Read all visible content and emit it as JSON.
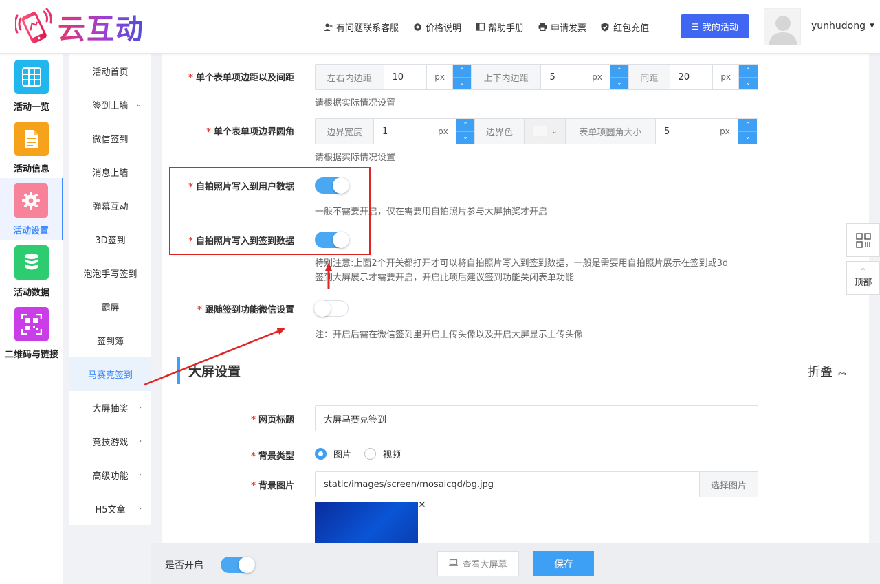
{
  "brand": {
    "name": "云互动"
  },
  "topnav": {
    "items": [
      {
        "label": "有问题联系客服",
        "icon": "user-plus-icon"
      },
      {
        "label": "价格说明",
        "icon": "gear-icon"
      },
      {
        "label": "帮助手册",
        "icon": "book-icon"
      },
      {
        "label": "申请发票",
        "icon": "printer-icon"
      },
      {
        "label": "红包充值",
        "icon": "shield-check-icon"
      }
    ],
    "my_activity": "我的活动",
    "username": "yunhudong"
  },
  "iconbar": {
    "items": [
      {
        "label": "活动一览",
        "icon": "grid-icon",
        "color": "#1fb7ee"
      },
      {
        "label": "活动信息",
        "icon": "document-icon",
        "color": "#f7a21b"
      },
      {
        "label": "活动设置",
        "icon": "settings-icon",
        "color": "#f36d8a",
        "active": true
      },
      {
        "label": "活动数据",
        "icon": "database-icon",
        "color": "#2ecc71"
      },
      {
        "label": "二维码与链接",
        "icon": "qrcode-icon",
        "color": "#c93ee6"
      }
    ]
  },
  "submenu": {
    "items": [
      {
        "label": "活动首页"
      },
      {
        "label": "签到上墙",
        "arrow": "chevron-down-icon"
      },
      {
        "label": "微信签到"
      },
      {
        "label": "消息上墙"
      },
      {
        "label": "弹幕互动"
      },
      {
        "label": "3D签到"
      },
      {
        "label": "泡泡手写签到"
      },
      {
        "label": "霸屏"
      },
      {
        "label": "签到簿"
      },
      {
        "label": "马赛克签到",
        "active": true
      },
      {
        "label": "大屏抽奖",
        "arrow": "chevron-right-icon"
      },
      {
        "label": "竞技游戏",
        "arrow": "chevron-right-icon"
      },
      {
        "label": "高级功能",
        "arrow": "chevron-right-icon"
      },
      {
        "label": "H5文章",
        "arrow": "chevron-right-icon"
      }
    ]
  },
  "form": {
    "spacing": {
      "label": "单个表单项边距以及间距",
      "padding_lr_label": "左右内边距",
      "padding_lr_value": "10",
      "unit": "px",
      "padding_tb_label": "上下内边距",
      "padding_tb_value": "5",
      "gap_label": "间距",
      "gap_value": "20",
      "hint": "请根据实际情况设置"
    },
    "border": {
      "label": "单个表单项边界圆角",
      "width_label": "边界宽度",
      "width_value": "1",
      "unit": "px",
      "color_label": "边界色",
      "radius_label": "表单项圆角大小",
      "radius_value": "5",
      "hint": "请根据实际情况设置"
    },
    "selfie_user": {
      "label": "自拍照片写入到用户数据",
      "on": true,
      "hint": "一般不需要开启，仅在需要用自拍照片参与大屏抽奖才开启"
    },
    "selfie_signin": {
      "label": "自拍照片写入到签到数据",
      "on": true,
      "hint_line1": "特别注意:上面2个开关都打开才可以将自拍照片写入到签到数据，一般是需要用自拍照片展示在签到或3d",
      "hint_line2": "签到大屏展示才需要开启，开启此项后建议签到功能关闭表单功能"
    },
    "follow_wechat": {
      "label": "跟随签到功能微信设置",
      "on": false,
      "hint": "注：开启后需在微信签到里开启上传头像以及开启大屏显示上传头像"
    }
  },
  "screen_section": {
    "title": "大屏设置",
    "fold_label": "折叠",
    "page_title_label": "网页标题",
    "page_title_value": "大屏马赛克签到",
    "bg_type_label": "背景类型",
    "bg_options": [
      {
        "label": "图片",
        "checked": true
      },
      {
        "label": "视频",
        "checked": false
      }
    ],
    "bg_image_label": "背景图片",
    "bg_image_value": "static/images/screen/mosaicqd/bg.jpg",
    "pick_image": "选择图片"
  },
  "float_tools": {
    "top_label": "顶部"
  },
  "footer": {
    "enabled_label": "是否开启",
    "enabled": true,
    "view_screen": "查看大屏幕",
    "save": "保存"
  },
  "colors": {
    "accent": "#3da0f5",
    "primary_button": "#4066f2",
    "annotation_red": "#e02323"
  }
}
